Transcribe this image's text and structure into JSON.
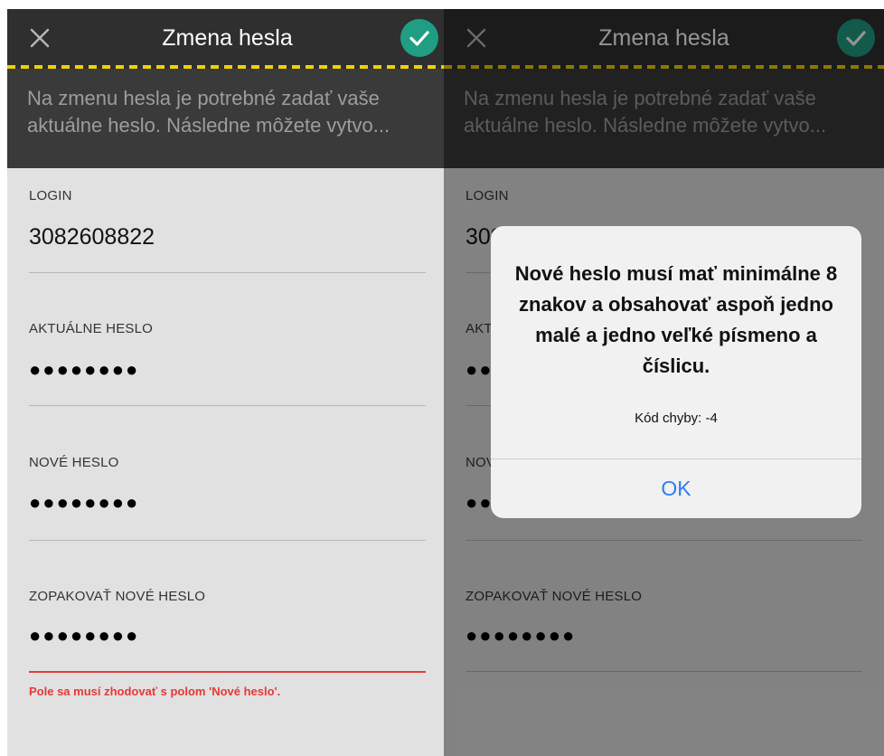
{
  "left": {
    "header": {
      "close_icon": "close-icon",
      "title": "Zmena hesla",
      "confirm_icon": "checkmark-icon",
      "accent_color": "#1f9e84",
      "dash_color": "#f0d000"
    },
    "info_text": "Na zmenu hesla je potrebné zadať vaše aktuálne heslo. Následne môžete vytvo...",
    "fields": [
      {
        "label": "LOGIN",
        "value": "3082608822"
      },
      {
        "label": "AKTUÁLNE HESLO",
        "value": "●●●●●●●●"
      },
      {
        "label": "NOVÉ HESLO",
        "value": "●●●●●●●●"
      },
      {
        "label": "ZOPAKOVAŤ NOVÉ HESLO",
        "value": "●●●●●●●●"
      }
    ],
    "error": "Pole sa musí zhodovať s polom 'Nové heslo'.",
    "error_color": "#e53935"
  },
  "right": {
    "header": {
      "close_icon": "close-icon",
      "title": "Zmena hesla",
      "confirm_icon": "checkmark-icon"
    },
    "info_text": "Na zmenu hesla je potrebné zadať vaše aktuálne heslo. Následne môžete vytvo...",
    "fields": [
      {
        "label": "LOGIN",
        "value": "3082608822"
      },
      {
        "label": "AKTUÁLNE HESLO",
        "value": "●●●●●●●●"
      },
      {
        "label": "NOVÉ HESLO",
        "value": "●●●●●●●●"
      },
      {
        "label": "ZOPAKOVAŤ NOVÉ HESLO",
        "value": "●●●●●●●●"
      }
    ],
    "alert": {
      "title": "Nové heslo musí mať minimálne 8 znakov a obsahovať aspoň jedno malé a jedno veľké písmeno a číslicu.",
      "message": "Kód chyby: -4",
      "ok_label": "OK",
      "ok_color": "#2c7cf6"
    }
  }
}
